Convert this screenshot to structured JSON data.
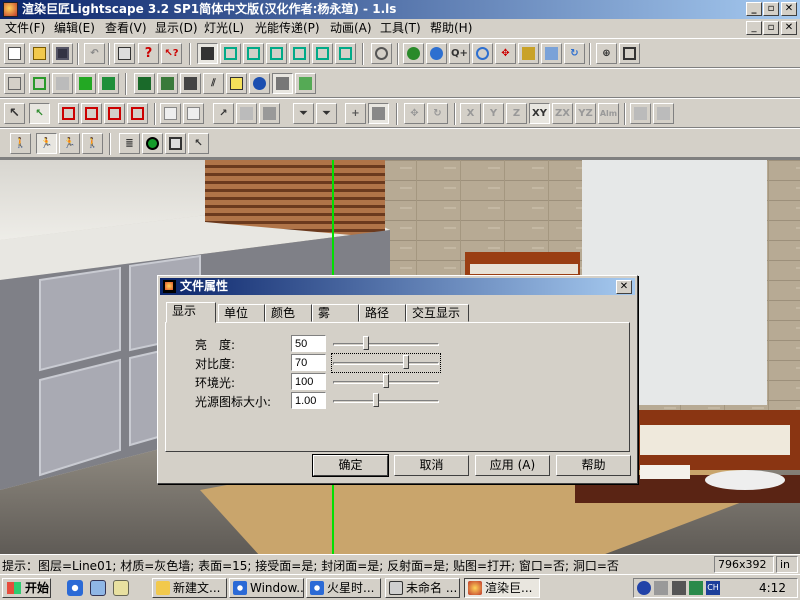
{
  "window": {
    "title": "渲染巨匠Lightscape 3.2 SP1简体中文版(汉化作者:杨永瑄) - 1.ls",
    "min_glyph": "_",
    "restore_glyph": "▫",
    "close_glyph": "✕"
  },
  "menu": [
    "文件(F)",
    "编辑(E)",
    "查看(V)",
    "显示(D)",
    "灯光(L)",
    "光能传递(P)",
    "动画(A)",
    "工具(T)",
    "帮助(H)"
  ],
  "mdi": {
    "min_glyph": "_",
    "restore_glyph": "▫",
    "close_glyph": "✕"
  },
  "toolbar": {
    "letters": [
      "X",
      "Y",
      "Z",
      "XY",
      "ZX",
      "YZ",
      "Alm"
    ]
  },
  "dialog": {
    "title": "文件属性",
    "close_glyph": "✕",
    "tabs": [
      "显示",
      "单位",
      "颜色",
      "雾",
      "路径",
      "交互显示"
    ],
    "active_tab": 0,
    "rows": [
      {
        "label": "亮　度:",
        "value": "50",
        "level": 0.3
      },
      {
        "label": "对比度:",
        "value": "70",
        "level": 0.7
      },
      {
        "label": "环境光:",
        "value": "100",
        "level": 0.5
      },
      {
        "label": "光源图标大小:",
        "value": "1.00",
        "level": 0.4
      }
    ],
    "buttons": {
      "ok": "确定",
      "cancel": "取消",
      "apply": "应用 (A)",
      "help": "帮助"
    }
  },
  "status": {
    "hint": "提示：图层=Line01; 材质=灰色墙; 表面=15; 接受面=是; 封闭面=是; 反射面=是; 贴图=打开; 窗口=否; 洞口=否",
    "size": "796x392",
    "unit": "in"
  },
  "taskbar": {
    "start": "开始",
    "tasks": [
      "新建文...",
      "Window...",
      "火星时...",
      "未命名 ...",
      "渲染巨..."
    ],
    "active_task": 4,
    "clock": "4:12",
    "lang": "CH"
  },
  "colors": {
    "title_start": "#0a246a",
    "title_end": "#a6caf0",
    "face": "#d4d0c8",
    "axis_green": "#00e000"
  }
}
